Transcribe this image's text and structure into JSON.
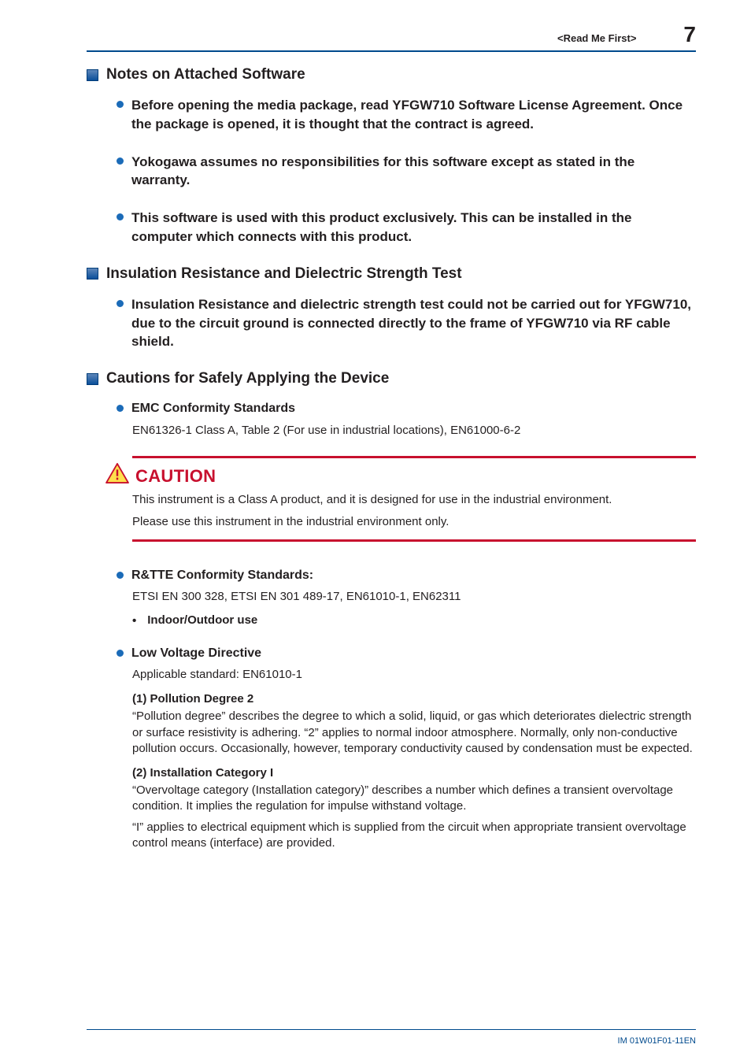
{
  "header": {
    "breadcrumb": "<Read Me First>",
    "page": "7"
  },
  "sections": {
    "software": {
      "title": "Notes on Attached Software",
      "items": [
        "Before opening the media package, read YFGW710 Software License Agreement. Once the package is opened, it is thought that the contract is agreed.",
        "Yokogawa assumes no responsibilities for this software except as stated in the warranty.",
        "This software is used with this product exclusively. This can be installed in the computer which connects with this product."
      ]
    },
    "insulation": {
      "title": "Insulation Resistance and Dielectric Strength Test",
      "items": [
        "Insulation Resistance and dielectric strength test could not be carried out for YFGW710, due to the circuit ground is connected directly to the frame of YFGW710 via RF cable shield."
      ]
    },
    "cautions": {
      "title": "Cautions for Safely Applying the Device",
      "emc": {
        "heading": "EMC Conformity Standards",
        "body": "EN61326-1 Class A, Table 2 (For use in industrial locations), EN61000-6-2"
      },
      "caution": {
        "label": "CAUTION",
        "l1": "This instrument is a Class A product, and it is designed for use in the industrial environment.",
        "l2": "Please use this instrument in the industrial environment only."
      },
      "rtte": {
        "heading": "R&TTE Conformity Standards:",
        "body": "ETSI EN 300 328, ETSI EN 301 489-17, EN61010-1, EN62311",
        "sub": "Indoor/Outdoor use"
      },
      "lvd": {
        "heading": "Low Voltage Directive",
        "body": "Applicable standard: EN61010-1",
        "p1": {
          "num": "(1)  Pollution Degree 2",
          "text": "“Pollution degree” describes the degree to which a solid, liquid, or gas which deteriorates dielectric strength or surface resistivity is adhering. “2” applies to normal indoor atmosphere. Normally, only non-conductive pollution occurs. Occasionally, however, temporary conductivity caused by condensation must be expected."
        },
        "p2": {
          "num": "(2)  Installation Category I",
          "t1": "“Overvoltage category (Installation category)” describes a number which defines a transient overvoltage condition. It implies the regulation for impulse withstand voltage.",
          "t2": "“I” applies to electrical equipment which is supplied from the circuit when appropriate transient overvoltage control means (interface) are provided."
        }
      }
    }
  },
  "footer": {
    "docnum": "IM 01W01F01-11EN"
  }
}
